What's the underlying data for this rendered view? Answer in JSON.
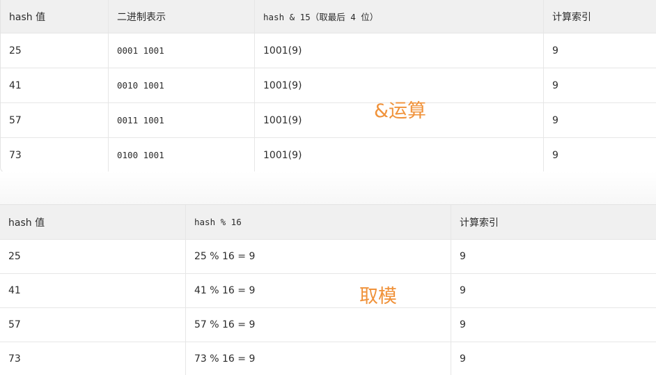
{
  "table1": {
    "headers": [
      "hash 值",
      "二进制表示",
      "hash & 15（取最后 4 位）",
      "计算索引"
    ],
    "rows": [
      [
        "25",
        "0001 1001",
        "1001(9)",
        "9"
      ],
      [
        "41",
        "0010 1001",
        "1001(9)",
        "9"
      ],
      [
        "57",
        "0011 1001",
        "1001(9)",
        "9"
      ],
      [
        "73",
        "0100 1001",
        "1001(9)",
        "9"
      ]
    ]
  },
  "annotation_and": "&运算",
  "table2": {
    "headers": [
      "hash 值",
      "hash % 16",
      "计算索引"
    ],
    "rows": [
      [
        "25",
        "25 % 16 = 9",
        "9"
      ],
      [
        "41",
        "41 % 16 = 9",
        "9"
      ],
      [
        "57",
        "57 % 16 = 9",
        "9"
      ],
      [
        "73",
        "73 % 16 = 9",
        "9"
      ]
    ]
  },
  "annotation_mod": "取模",
  "colors": {
    "annotation": "#f0923a",
    "header_bg": "#f0f0f0",
    "border": "#e6e6e6"
  }
}
